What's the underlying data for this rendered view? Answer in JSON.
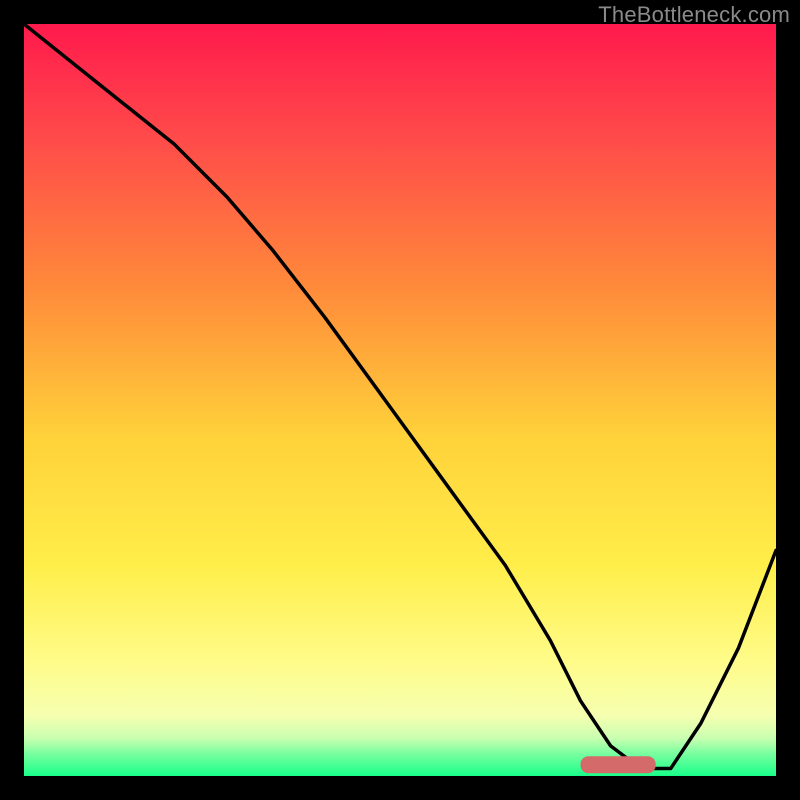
{
  "watermark": "TheBottleneck.com",
  "gradient_stops": [
    {
      "pct": 0,
      "color": "#ff1a4d"
    },
    {
      "pct": 15,
      "color": "#ff4a4a"
    },
    {
      "pct": 35,
      "color": "#ff8a3a"
    },
    {
      "pct": 55,
      "color": "#ffd23a"
    },
    {
      "pct": 72,
      "color": "#ffee4a"
    },
    {
      "pct": 85,
      "color": "#fffc8a"
    },
    {
      "pct": 92,
      "color": "#f5ffb0"
    },
    {
      "pct": 95,
      "color": "#c8ffb0"
    },
    {
      "pct": 97,
      "color": "#7affa0"
    },
    {
      "pct": 100,
      "color": "#18ff8a"
    }
  ],
  "curve_color": "#000000",
  "marker": {
    "color": "#d46a6a",
    "x_frac_start": 0.74,
    "x_frac_end": 0.84,
    "y_frac": 0.985,
    "thickness": 17,
    "radius": 8
  },
  "chart_data": {
    "type": "line",
    "title": "",
    "xlabel": "",
    "ylabel": "",
    "xlim": [
      0,
      100
    ],
    "ylim": [
      0,
      100
    ],
    "series": [
      {
        "name": "bottleneck-curve",
        "x": [
          0,
          10,
          20,
          27,
          33,
          40,
          48,
          56,
          64,
          70,
          74,
          78,
          82,
          86,
          90,
          95,
          100
        ],
        "y": [
          100,
          92,
          84,
          77,
          70,
          61,
          50,
          39,
          28,
          18,
          10,
          4,
          1,
          1,
          7,
          17,
          30
        ]
      }
    ],
    "highlight_range_x": [
      74,
      84
    ]
  }
}
